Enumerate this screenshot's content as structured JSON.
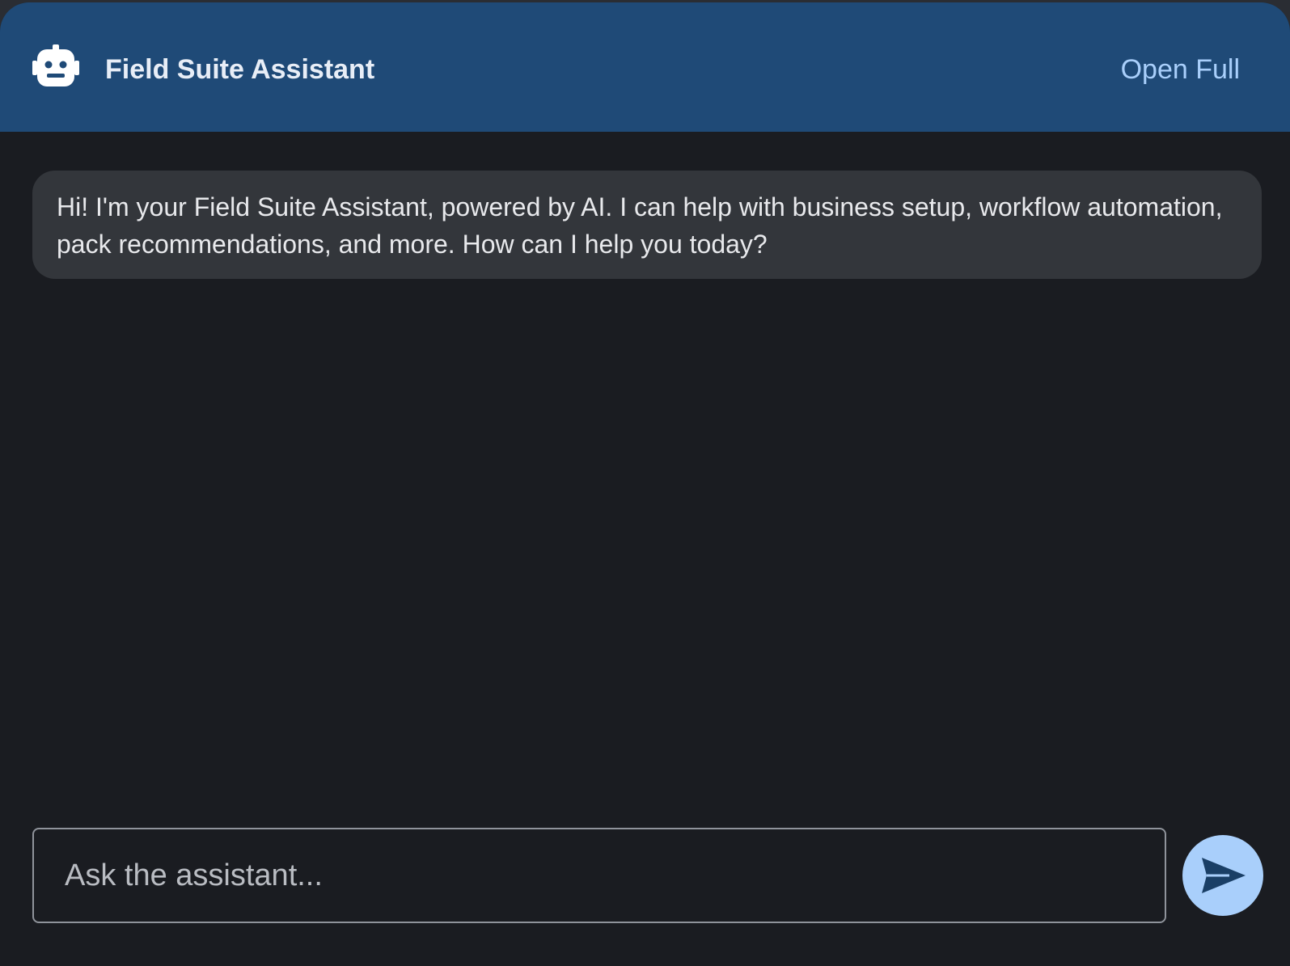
{
  "header": {
    "icon": "robot-icon",
    "title": "Field Suite Assistant",
    "open_full_label": "Open Full"
  },
  "messages": [
    {
      "role": "assistant",
      "text": "Hi! I'm your Field Suite Assistant, powered by AI. I can help with business setup, workflow automation, pack recommendations, and more. How can I help you today?"
    }
  ],
  "composer": {
    "placeholder": "Ask the assistant...",
    "value": "",
    "send_icon": "send-icon"
  },
  "colors": {
    "header_bg": "#1f4a77",
    "panel_bg": "#1a1c21",
    "bubble_bg": "#33363b",
    "accent": "#a9cffb"
  }
}
